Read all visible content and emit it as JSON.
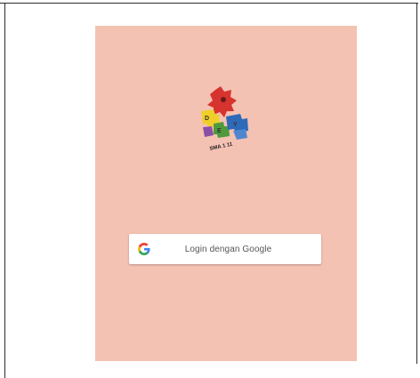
{
  "login": {
    "button_label": "Login dengan Google",
    "icon": "google-icon"
  },
  "logo": {
    "icon": "puzzle-logo-icon",
    "caption": "SMA 1 11"
  },
  "colors": {
    "screen_background": "#f4c2b3",
    "button_background": "#ffffff",
    "frame_line": "#2b2b2b"
  }
}
